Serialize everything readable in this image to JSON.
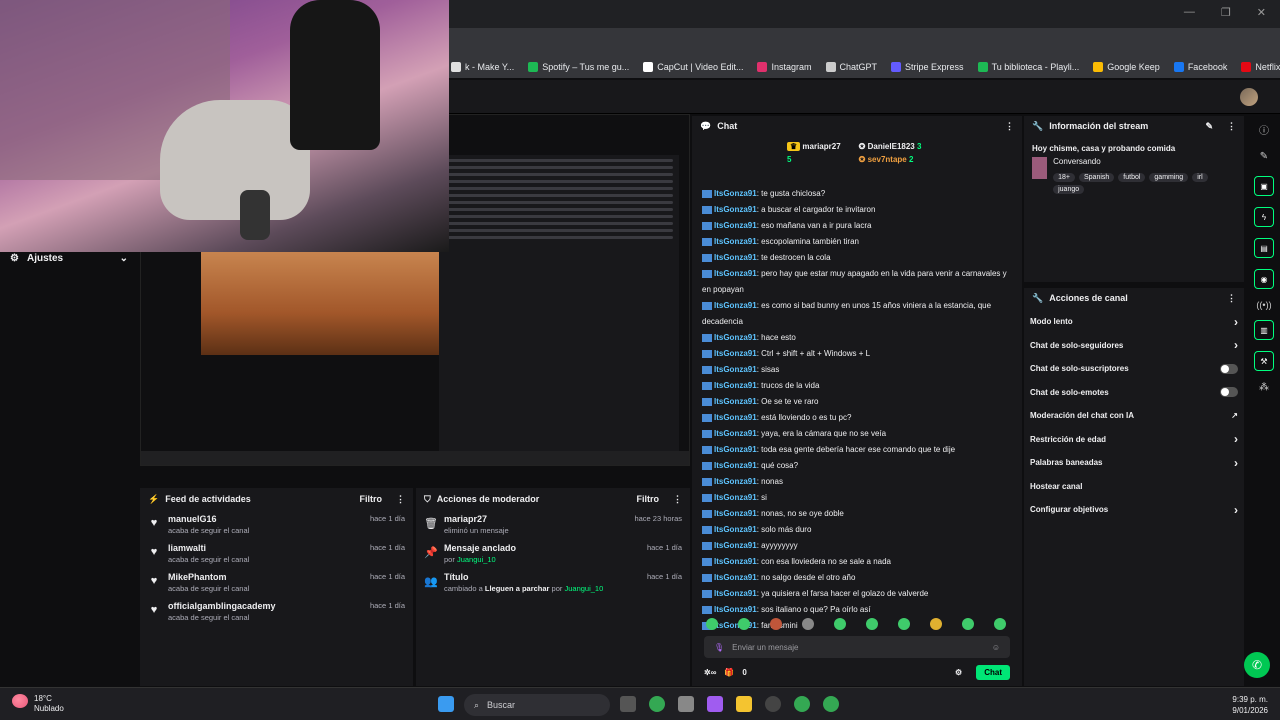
{
  "browser": {
    "bookmarks": [
      {
        "label": "k - Make Y...",
        "color": "#e0e0e0"
      },
      {
        "label": "Spotify – Tus me gu...",
        "color": "#1db954"
      },
      {
        "label": "CapCut | Video Edit...",
        "color": "#ffffff"
      },
      {
        "label": "Instagram",
        "color": "#e1306c"
      },
      {
        "label": "ChatGPT",
        "color": "#cccccc"
      },
      {
        "label": "Stripe Express",
        "color": "#635bff"
      },
      {
        "label": "Tu biblioteca - Playli...",
        "color": "#1db954"
      },
      {
        "label": "Google Keep",
        "color": "#fbbc04"
      },
      {
        "label": "Facebook",
        "color": "#1877f2"
      },
      {
        "label": "Netflix",
        "color": "#e50914"
      }
    ]
  },
  "left": {
    "ajustes": "Ajustes"
  },
  "feed": {
    "title": "Feed de actividades",
    "filter": "Filtro",
    "items": [
      {
        "name": "manuelG16",
        "sub": "acaba de seguir el canal",
        "time": "hace 1 día"
      },
      {
        "name": "liamwalti",
        "sub": "acaba de seguir el canal",
        "time": "hace 1 día"
      },
      {
        "name": "MikePhantom",
        "sub": "acaba de seguir el canal",
        "time": "hace 1 día"
      },
      {
        "name": "officialgamblingacademy",
        "sub": "acaba de seguir el canal",
        "time": "hace 1 día"
      }
    ]
  },
  "mod": {
    "title": "Acciones de moderador",
    "filter": "Filtro",
    "items": [
      {
        "icon": "🗑",
        "name": "mariapr27",
        "sub": "eliminó un mensaje",
        "time": "hace 23 horas"
      },
      {
        "icon": "📌",
        "name": "Mensaje anclado",
        "sub_pre": "por ",
        "sub_user": "Juangui_10",
        "time": "hace 1 día"
      },
      {
        "icon": "👥",
        "name": "Título",
        "sub_pre": "cambiado a ",
        "sub_bold": "Lleguen a parchar",
        "sub_mid": " por ",
        "sub_user": "Juangui_10",
        "time": "hace 1 día"
      }
    ]
  },
  "chat": {
    "title": "Chat",
    "pinned": {
      "u1": "mariapr27",
      "c1": "5",
      "u2": "DanielE1823",
      "c2": "3",
      "u3": "sev7ntape",
      "c3": "2"
    },
    "messages": [
      {
        "user": "ItsGonza91",
        "text": "te gusta chiclosa?"
      },
      {
        "user": "ItsGonza91",
        "text": "a buscar el cargador te invitaron"
      },
      {
        "user": "ItsGonza91",
        "text": "eso mañana van a ir pura lacra"
      },
      {
        "user": "ItsGonza91",
        "text": "escopolamina también tiran"
      },
      {
        "user": "ItsGonza91",
        "text": "te destrocen la cola"
      },
      {
        "user": "ItsGonza91",
        "text": "pero hay que estar muy apagado en la vida para venir a carnavales y en popayan"
      },
      {
        "user": "ItsGonza91",
        "text": "es como si bad bunny en unos 15 años viniera a la estancia, que decadencia"
      },
      {
        "user": "ItsGonza91",
        "text": "hace esto"
      },
      {
        "user": "ItsGonza91",
        "text": "Ctrl + shift + alt + Windows + L"
      },
      {
        "user": "ItsGonza91",
        "text": "sisas"
      },
      {
        "user": "ItsGonza91",
        "text": "trucos de la vida"
      },
      {
        "user": "ItsGonza91",
        "text": "Oe se te ve raro"
      },
      {
        "user": "ItsGonza91",
        "text": "está lloviendo o es tu pc?"
      },
      {
        "user": "ItsGonza91",
        "text": "yaya, era la cámara que no se veía"
      },
      {
        "user": "ItsGonza91",
        "text": "toda esa gente debería hacer ese comando que te dije"
      },
      {
        "user": "ItsGonza91",
        "text": "qué cosa?"
      },
      {
        "user": "ItsGonza91",
        "text": "nonas"
      },
      {
        "user": "ItsGonza91",
        "text": "si"
      },
      {
        "user": "ItsGonza91",
        "text": "nonas, no se oye doble"
      },
      {
        "user": "ItsGonza91",
        "text": "solo más duro"
      },
      {
        "user": "ItsGonza91",
        "text": "ayyyyyyyy"
      },
      {
        "user": "ItsGonza91",
        "text": "con esa lloviedera no se sale a nada"
      },
      {
        "user": "ItsGonza91",
        "text": "no salgo desde el otro año"
      },
      {
        "user": "ItsGonza91",
        "text": "ya quisiera el farsa hacer el golazo de valverde"
      },
      {
        "user": "ItsGonza91",
        "text": "sos italiano o que? Pa oírlo así"
      },
      {
        "user": "ItsGonza91",
        "text": "fantasmini"
      }
    ],
    "placeholder": "Enviar un mensaje",
    "points": "0",
    "send": "Chat"
  },
  "info": {
    "title": "Información del stream",
    "stream_title": "Hoy chisme, casa y probando comida",
    "category": "Conversando",
    "tags": [
      "18+",
      "Spanish",
      "futbol",
      "gamming",
      "irl",
      "juango"
    ]
  },
  "actions": {
    "title": "Acciones de canal",
    "items": [
      {
        "label": "Modo lento",
        "ctl": "arrow"
      },
      {
        "label": "Chat de solo-seguidores",
        "ctl": "arrow"
      },
      {
        "label": "Chat de solo-suscriptores",
        "ctl": "toggle"
      },
      {
        "label": "Chat de solo-emotes",
        "ctl": "toggle"
      },
      {
        "label": "Moderación del chat con IA",
        "ctl": "ext"
      },
      {
        "label": "Restricción de edad",
        "ctl": "arrow"
      },
      {
        "label": "Palabras baneadas",
        "ctl": "arrow"
      },
      {
        "label": "Hostear canal",
        "ctl": "none"
      },
      {
        "label": "Configurar objetivos",
        "ctl": "arrow"
      }
    ]
  },
  "taskbar": {
    "temp": "18°C",
    "weather": "Nublado",
    "search": "Buscar",
    "time": "9:39 p. m.",
    "date": "9/01/2026"
  }
}
